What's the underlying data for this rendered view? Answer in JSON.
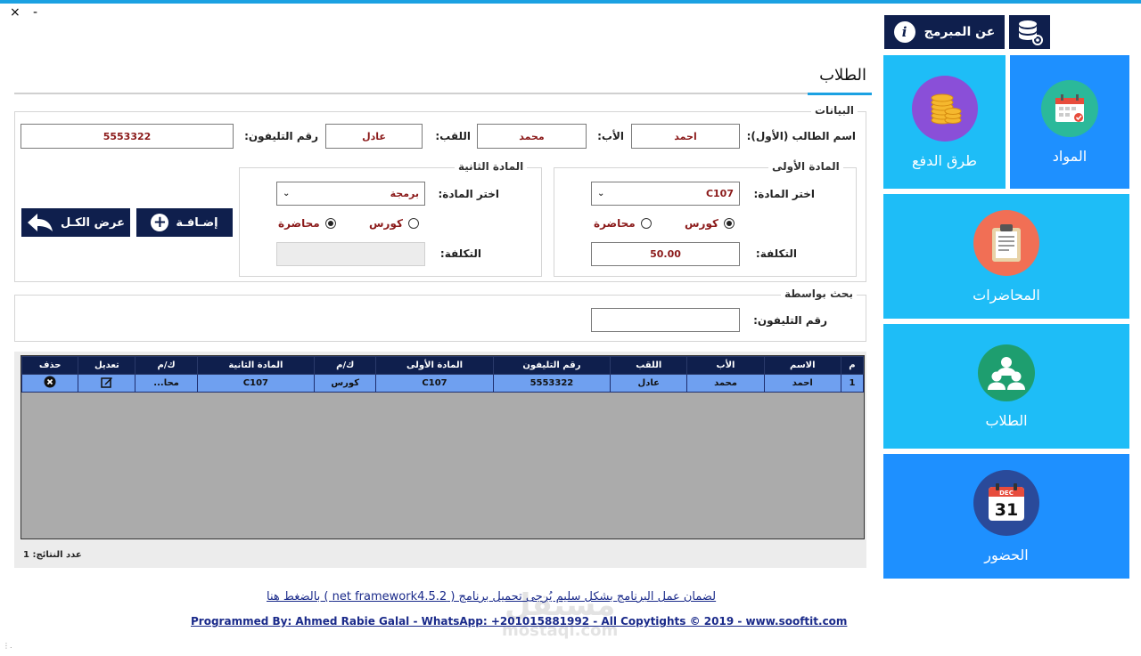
{
  "window": {
    "close_glyph": "×",
    "minimize_glyph": "-"
  },
  "header": {
    "about_label": "عن المبرمج",
    "info_icon": "info-icon",
    "db_icon": "database-settings-icon"
  },
  "sidebar": {
    "tiles": [
      {
        "label": "المواد",
        "icon": "calendar-icon",
        "color": "#1e90ff"
      },
      {
        "label": "طرق الدفع",
        "icon": "coins-icon",
        "color": "#1ebdf7"
      },
      {
        "label": "المحاضرات",
        "icon": "clipboard-icon",
        "color": "#1ebdf7"
      },
      {
        "label": "الطلاب",
        "icon": "users-icon",
        "color": "#1ebdf7"
      },
      {
        "label": "الحضور",
        "icon": "calendar-date-icon",
        "color": "#1e90ff"
      }
    ],
    "calendar_month": "DEC",
    "calendar_day": "31"
  },
  "page": {
    "title": "الطلاب"
  },
  "data_section": {
    "title": "البيانات",
    "student_name_label": "اسم الطالب (الأول):",
    "student_name_value": "احمد",
    "father_label": "الأب:",
    "father_value": "محمد",
    "surname_label": "اللقب:",
    "surname_value": "عادل",
    "phone_label": "رقم التليفون:",
    "phone_value": "5553322"
  },
  "subject1": {
    "title": "المادة الأولى",
    "choose_label": "اختر المادة:",
    "choose_value": "C107",
    "radio_course": "كورس",
    "radio_lecture": "محاضرة",
    "selected": "course",
    "cost_label": "التكلفة:",
    "cost_value": "50.00"
  },
  "subject2": {
    "title": "المادة الثانية",
    "choose_label": "اختر المادة:",
    "choose_value": "برمجة",
    "radio_course": "كورس",
    "radio_lecture": "محاضرة",
    "selected": "lecture",
    "cost_label": "التكلفة:",
    "cost_value": ""
  },
  "actions": {
    "add_label": "إضـافـة",
    "show_all_label": "عرض الكـل"
  },
  "search": {
    "title": "بحث بواسطة",
    "phone_label": "رقم التليفون:",
    "phone_value": ""
  },
  "table": {
    "headers": [
      "م",
      "الاسم",
      "الأب",
      "اللقب",
      "رقم التليفون",
      "المادة الأولى",
      "ك/م",
      "المادة الثانية",
      "ك/م",
      "تعديل",
      "حذف"
    ],
    "rows": [
      [
        "1",
        "احمد",
        "محمد",
        "عادل",
        "5553322",
        "C107",
        "كورس",
        "C107",
        "محا...",
        "edit-icon",
        "delete-icon"
      ]
    ],
    "results_count": "عدد النتائج: 1"
  },
  "footer": {
    "link1": "لضمان عمل البرنامج بشكل سليم يُرجى تحميل برنامج ( net framework4.5.2 ) بالضغط هنا",
    "link2": "Programmed By: Ahmed Rabie Galal - WhatsApp: +201015881992 - All Copytights © 2019 - www.sooftit.com"
  },
  "watermark": {
    "arabic": "مستقل",
    "latin": "mostaql.com"
  }
}
